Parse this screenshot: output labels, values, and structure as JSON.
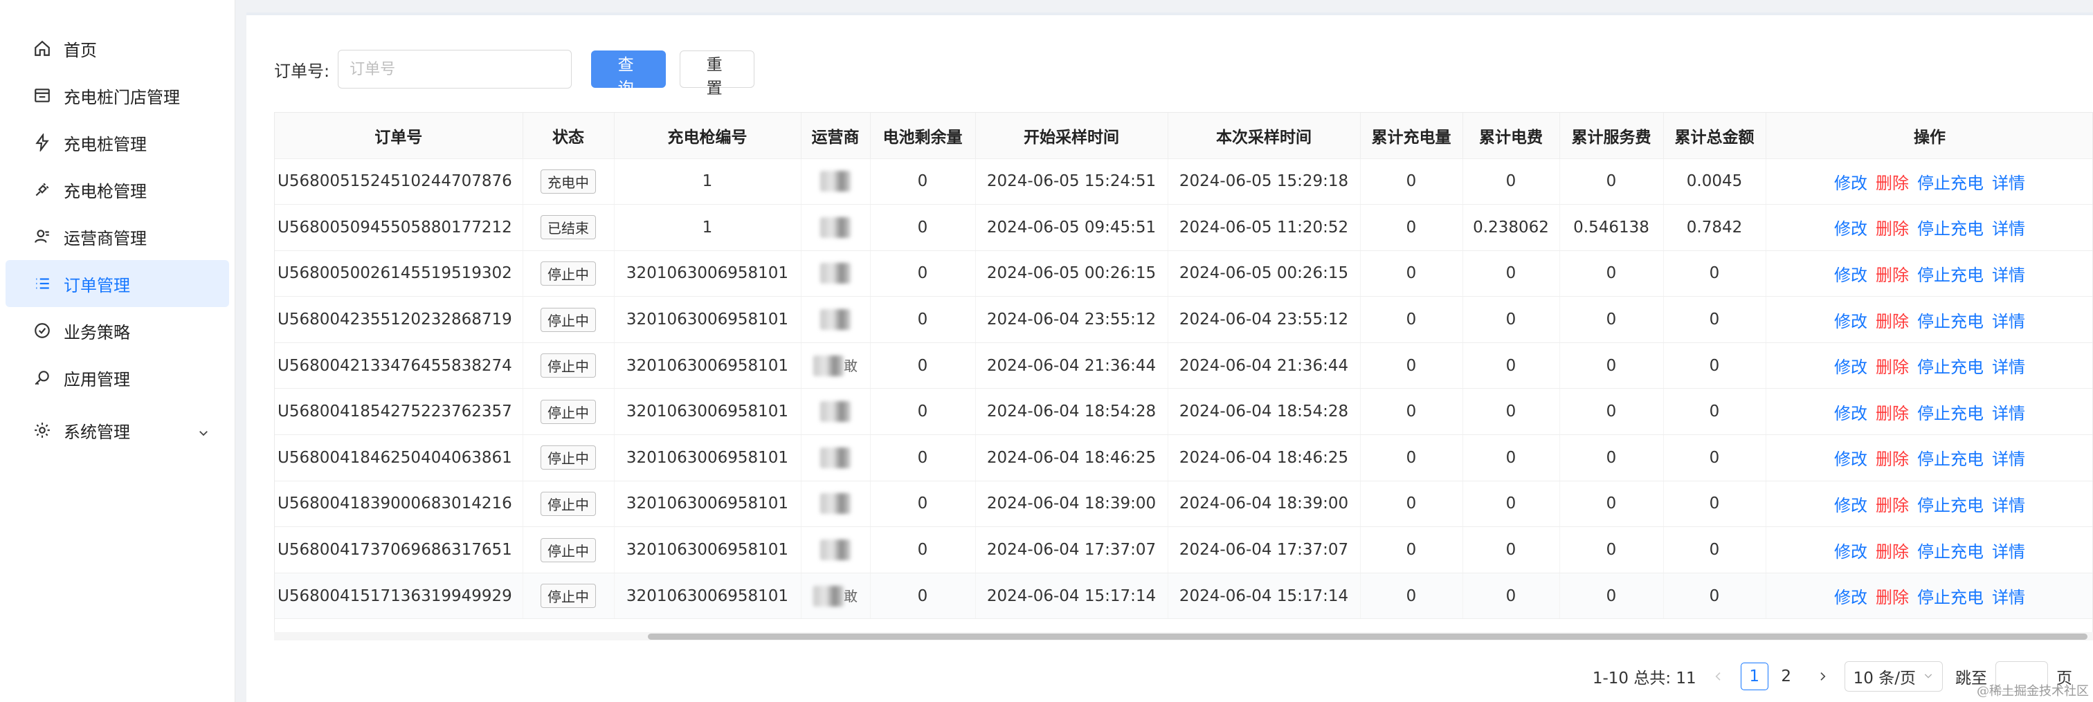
{
  "sidebar": {
    "items": [
      {
        "label": "首页",
        "icon": "home-icon"
      },
      {
        "label": "充电桩门店管理",
        "icon": "store-icon"
      },
      {
        "label": "充电桩管理",
        "icon": "lightning-icon"
      },
      {
        "label": "充电枪管理",
        "icon": "plug-icon"
      },
      {
        "label": "运营商管理",
        "icon": "user-group-icon"
      },
      {
        "label": "订单管理",
        "icon": "list-icon",
        "active": true
      },
      {
        "label": "业务策略",
        "icon": "strategy-icon"
      },
      {
        "label": "应用管理",
        "icon": "key-icon"
      },
      {
        "label": "系统管理",
        "icon": "gear-icon",
        "expandable": true
      }
    ]
  },
  "search": {
    "label": "订单号:",
    "placeholder": "订单号",
    "value": "",
    "query_label": "查询",
    "reset_label": "重置"
  },
  "table": {
    "columns": [
      "订单号",
      "状态",
      "充电枪编号",
      "运营商",
      "电池剩余量",
      "开始采样时间",
      "本次采样时间",
      "累计充电量",
      "累计电费",
      "累计服务费",
      "累计总金额",
      "操作"
    ],
    "actions": {
      "edit": "修改",
      "delete": "删除",
      "stop": "停止充电",
      "detail": "详情"
    },
    "rows": [
      {
        "order": "U5680051524510244707876",
        "status": "充电中",
        "gun": "1",
        "op_tail": "",
        "battery": "0",
        "start": "2024-06-05 15:24:51",
        "sample": "2024-06-05 15:29:18",
        "energy": "0",
        "fee": "0",
        "service": "0",
        "total": "0.0045"
      },
      {
        "order": "U5680050945505880177212",
        "status": "已结束",
        "gun": "1",
        "op_tail": "",
        "battery": "0",
        "start": "2024-06-05 09:45:51",
        "sample": "2024-06-05 11:20:52",
        "energy": "0",
        "fee": "0.238062",
        "service": "0.546138",
        "total": "0.7842"
      },
      {
        "order": "U5680050026145519519302",
        "status": "停止中",
        "gun": "3201063006958101",
        "op_tail": "",
        "battery": "0",
        "start": "2024-06-05 00:26:15",
        "sample": "2024-06-05 00:26:15",
        "energy": "0",
        "fee": "0",
        "service": "0",
        "total": "0"
      },
      {
        "order": "U5680042355120232868719",
        "status": "停止中",
        "gun": "3201063006958101",
        "op_tail": "",
        "battery": "0",
        "start": "2024-06-04 23:55:12",
        "sample": "2024-06-04 23:55:12",
        "energy": "0",
        "fee": "0",
        "service": "0",
        "total": "0"
      },
      {
        "order": "U5680042133476455838274",
        "status": "停止中",
        "gun": "3201063006958101",
        "op_tail": "敢",
        "battery": "0",
        "start": "2024-06-04 21:36:44",
        "sample": "2024-06-04 21:36:44",
        "energy": "0",
        "fee": "0",
        "service": "0",
        "total": "0"
      },
      {
        "order": "U5680041854275223762357",
        "status": "停止中",
        "gun": "3201063006958101",
        "op_tail": "",
        "battery": "0",
        "start": "2024-06-04 18:54:28",
        "sample": "2024-06-04 18:54:28",
        "energy": "0",
        "fee": "0",
        "service": "0",
        "total": "0"
      },
      {
        "order": "U5680041846250404063861",
        "status": "停止中",
        "gun": "3201063006958101",
        "op_tail": "",
        "battery": "0",
        "start": "2024-06-04 18:46:25",
        "sample": "2024-06-04 18:46:25",
        "energy": "0",
        "fee": "0",
        "service": "0",
        "total": "0"
      },
      {
        "order": "U5680041839000683014216",
        "status": "停止中",
        "gun": "3201063006958101",
        "op_tail": "",
        "battery": "0",
        "start": "2024-06-04 18:39:00",
        "sample": "2024-06-04 18:39:00",
        "energy": "0",
        "fee": "0",
        "service": "0",
        "total": "0"
      },
      {
        "order": "U5680041737069686317651",
        "status": "停止中",
        "gun": "3201063006958101",
        "op_tail": "",
        "battery": "0",
        "start": "2024-06-04 17:37:07",
        "sample": "2024-06-04 17:37:07",
        "energy": "0",
        "fee": "0",
        "service": "0",
        "total": "0"
      },
      {
        "order": "U5680041517136319949929",
        "status": "停止中",
        "gun": "3201063006958101",
        "op_tail": "敢",
        "battery": "0",
        "start": "2024-06-04 15:17:14",
        "sample": "2024-06-04 15:17:14",
        "energy": "0",
        "fee": "0",
        "service": "0",
        "total": "0"
      }
    ]
  },
  "pagination": {
    "summary": "1-10 总共: 11",
    "pages": [
      "1",
      "2"
    ],
    "current_page": "1",
    "page_size": "10 条/页",
    "jump_label": "跳至",
    "jump_suffix": "页"
  },
  "watermark": "@稀土掘金技术社区",
  "colors": {
    "accent": "#1677ff",
    "danger": "#ff3b3b",
    "primary_button": "#4a8ff5"
  }
}
